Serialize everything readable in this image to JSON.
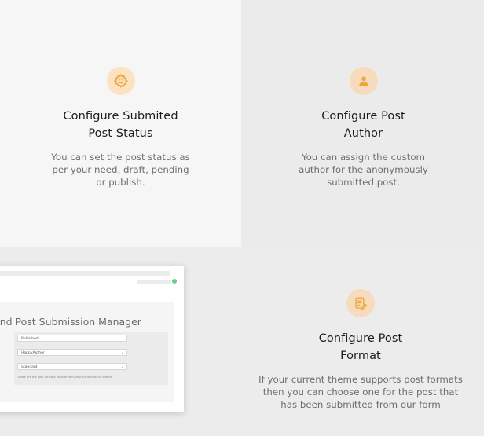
{
  "features": {
    "status": {
      "icon": "gear-icon",
      "title_line1": "Configure Submited",
      "title_line2": "Post Status",
      "description": "You can set the post status as per your need, draft, pending or publish."
    },
    "author": {
      "icon": "user-icon",
      "title_line1": "Configure Post",
      "title_line2": "Author",
      "description": "You can assign the custom author for the anonymously submitted post."
    },
    "format": {
      "icon": "document-edit-icon",
      "title_line1": "Configure Post",
      "title_line2": "Format",
      "description": "If your current theme supports post formats then you can choose one for the post that has been submitted from our form"
    }
  },
  "screenshot": {
    "heading": "end Post Submission Manager",
    "select_status": "Published",
    "select_author": "HappyAuthor",
    "select_format": "Standard",
    "hint": "These are the post formats registered in your current active theme"
  },
  "colors": {
    "icon_bg": "#fbe2c3",
    "icon_fg": "#f0a43a"
  }
}
